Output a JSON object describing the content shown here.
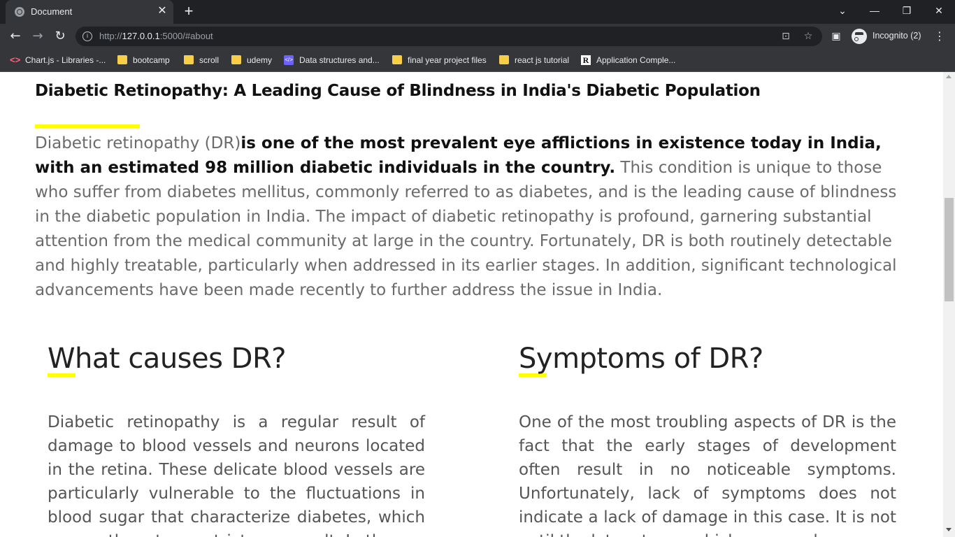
{
  "browser": {
    "tab_title": "Document",
    "tab_close": "✕",
    "new_tab": "+",
    "url_prefix": "http://",
    "url_host": "127.0.0.1",
    "url_rest": ":5000/#about",
    "profile_label": "Incognito (2)",
    "window_controls": {
      "dropdown": "⌄",
      "minimize": "—",
      "restore": "❐",
      "close": "✕"
    },
    "nav": {
      "back": "←",
      "forward": "→",
      "reload": "↻"
    },
    "bookmarks": [
      {
        "label": "Chart.js - Libraries -...",
        "icon": "chartjs-icon"
      },
      {
        "label": "bootcamp",
        "icon": "folder-icon"
      },
      {
        "label": "scroll",
        "icon": "folder-icon"
      },
      {
        "label": "udemy",
        "icon": "folder-icon"
      },
      {
        "label": "Data structures and...",
        "icon": "code-icon"
      },
      {
        "label": "final year project files",
        "icon": "folder-icon"
      },
      {
        "label": "react js tutorial",
        "icon": "folder-icon"
      },
      {
        "label": "Application Comple...",
        "icon": "r-logo-icon"
      }
    ]
  },
  "page": {
    "title": "Diabetic Retinopathy: A Leading Cause of Blindness in India's Diabetic Population",
    "intro_lead": "Diabetic retinopathy (DR)",
    "intro_bold": "is one of the most prevalent eye afflictions in existence today in India, with an estimated 98 million diabetic individuals in the country.",
    "intro_rest": " This condition is unique to those who suffer from diabetes mellitus, commonly referred to as diabetes, and is the leading cause of blindness in the diabetic population in India. The impact of diabetic retinopathy is profound, garnering substantial attention from the medical community at large in the country. Fortunately, DR is both routinely detectable and highly treatable, particularly when addressed in its earlier stages. In addition, significant technological advancements have been made recently to further address the issue in India.",
    "causes": {
      "heading": "What causes DR?",
      "text": "Diabetic retinopathy is a regular result of damage to blood vessels and neurons located in the retina. These delicate blood vessels are particularly vulnerable to the fluctuations in blood sugar that characterize diabetes, which causes them to constrict as a result. In the"
    },
    "symptoms": {
      "heading": "Symptoms of DR?",
      "text": "One of the most troubling aspects of DR is the fact that the early stages of development often result in no noticeable symptoms. Unfortunately, lack of symptoms does not indicate a lack of damage in this case. It is not until the later stages which commonly occur"
    }
  },
  "colors": {
    "accent": "#ffff00",
    "chrome_dark": "#202124",
    "chrome_mid": "#35363a"
  }
}
